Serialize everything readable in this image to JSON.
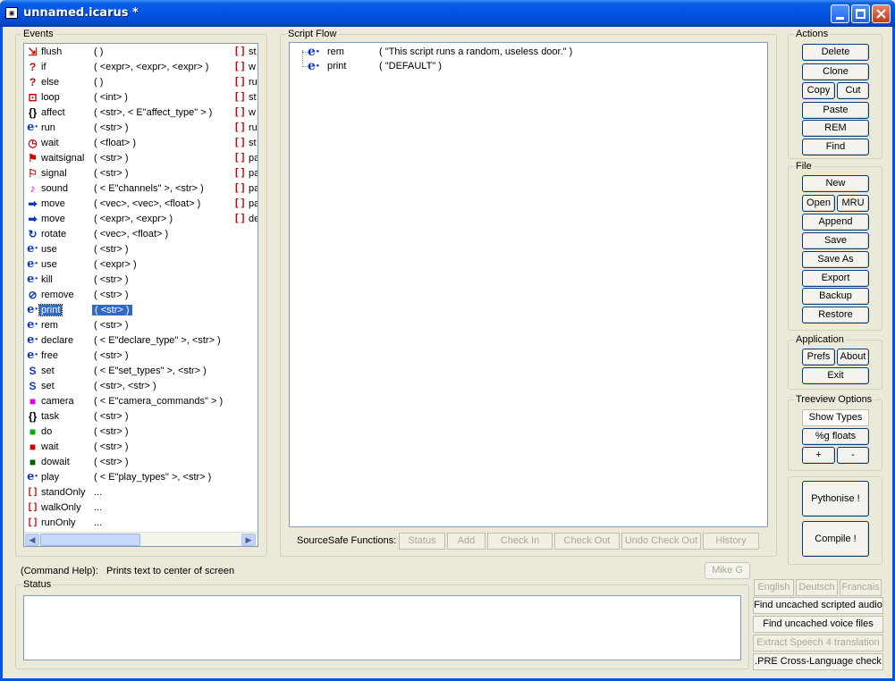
{
  "window": {
    "title": "unnamed.icarus *",
    "icon": "app-icon"
  },
  "events": {
    "legend": "Events",
    "items": [
      {
        "icon": "flush-icon",
        "glyph": "⇲",
        "color": "#d00000",
        "name": "flush",
        "args": "(   )"
      },
      {
        "icon": "if-icon",
        "glyph": "?",
        "color": "#d00000",
        "name": "if",
        "args": "( <expr>, <expr>, <expr> )"
      },
      {
        "icon": "else-icon",
        "glyph": "?",
        "color": "#d00000",
        "name": "else",
        "args": "(   )"
      },
      {
        "icon": "loop-icon",
        "glyph": "⊡",
        "color": "#d00000",
        "name": "loop",
        "args": "( <int> )"
      },
      {
        "icon": "affect-icon",
        "glyph": "{}",
        "color": "#000000",
        "name": "affect",
        "args": "( <str>, < E\"affect_type\" > )"
      },
      {
        "icon": "run-icon",
        "glyph": "e·",
        "color": "#0b36c8",
        "name": "run",
        "args": "( <str> )"
      },
      {
        "icon": "wait-clock-icon",
        "glyph": "◷",
        "color": "#d00000",
        "name": "wait",
        "args": "( <float> )"
      },
      {
        "icon": "waitsignal-icon",
        "glyph": "⚑",
        "color": "#d00000",
        "name": "waitsignal",
        "args": "( <str> )"
      },
      {
        "icon": "signal-icon",
        "glyph": "⚐",
        "color": "#d00000",
        "name": "signal",
        "args": "( <str> )"
      },
      {
        "icon": "sound-icon",
        "glyph": "♪",
        "color": "#e000e0",
        "name": "sound",
        "args": "( < E\"channels\" >, <str> )"
      },
      {
        "icon": "move-arrow-icon",
        "glyph": "➡",
        "color": "#0b36c8",
        "name": "move",
        "args": "( <vec>, <vec>, <float> )"
      },
      {
        "icon": "move-arrow-icon",
        "glyph": "➡",
        "color": "#0b36c8",
        "name": "move",
        "args": "( <expr>, <expr> )"
      },
      {
        "icon": "rotate-icon",
        "glyph": "↻",
        "color": "#0b36c8",
        "name": "rotate",
        "args": "( <vec>, <float> )"
      },
      {
        "icon": "use-icon",
        "glyph": "e·",
        "color": "#0b36c8",
        "name": "use",
        "args": "( <str> )"
      },
      {
        "icon": "use-icon",
        "glyph": "e·",
        "color": "#0b36c8",
        "name": "use",
        "args": "( <expr> )"
      },
      {
        "icon": "kill-icon",
        "glyph": "e·",
        "color": "#0b36c8",
        "name": "kill",
        "args": "( <str> )"
      },
      {
        "icon": "remove-icon",
        "glyph": "⊘",
        "color": "#0b36c8",
        "name": "remove",
        "args": "( <str> )"
      },
      {
        "icon": "print-icon",
        "glyph": "e·",
        "color": "#0b36c8",
        "name": "print",
        "args": "( <str> )"
      },
      {
        "icon": "rem-icon",
        "glyph": "e·",
        "color": "#0b36c8",
        "name": "rem",
        "args": "( <str> )"
      },
      {
        "icon": "declare-icon",
        "glyph": "e·",
        "color": "#0b36c8",
        "name": "declare",
        "args": "( < E\"declare_type\" >, <str> )"
      },
      {
        "icon": "free-icon",
        "glyph": "e·",
        "color": "#0b36c8",
        "name": "free",
        "args": "( <str> )"
      },
      {
        "icon": "set-icon",
        "glyph": "S",
        "color": "#0b36c8",
        "name": "set",
        "args": "( < E\"set_types\" >, <str> )"
      },
      {
        "icon": "set-icon",
        "glyph": "S",
        "color": "#0b36c8",
        "name": "set",
        "args": "( <str>, <str> )"
      },
      {
        "icon": "camera-icon",
        "glyph": "■",
        "color": "#e000e0",
        "name": "camera",
        "args": "( < E\"camera_commands\" > )"
      },
      {
        "icon": "task-icon",
        "glyph": "{}",
        "color": "#000000",
        "name": "task",
        "args": "( <str> )"
      },
      {
        "icon": "do-icon",
        "glyph": "■",
        "color": "#00b000",
        "name": "do",
        "args": "( <str> )"
      },
      {
        "icon": "wait-red-icon",
        "glyph": "■",
        "color": "#d00000",
        "name": "wait",
        "args": "( <str> )"
      },
      {
        "icon": "dowait-icon",
        "glyph": "■",
        "color": "#006000",
        "name": "dowait",
        "args": "( <str> )"
      },
      {
        "icon": "play-icon",
        "glyph": "e·",
        "color": "#0b36c8",
        "name": "play",
        "args": "( < E\"play_types\" >, <str> )"
      },
      {
        "icon": "standonly-icon",
        "glyph": "[ ]",
        "color": "#d00000",
        "name": "standOnly",
        "args": "..."
      },
      {
        "icon": "walkonly-icon",
        "glyph": "[ ]",
        "color": "#d00000",
        "name": "walkOnly",
        "args": "..."
      },
      {
        "icon": "runonly-icon",
        "glyph": "[ ]",
        "color": "#d00000",
        "name": "runOnly",
        "args": "..."
      }
    ],
    "selected_index": 17,
    "second_column": [
      {
        "icon": "bracket-icon",
        "glyph": "[ ]",
        "name": "st"
      },
      {
        "icon": "bracket-icon",
        "glyph": "[ ]",
        "name": "w"
      },
      {
        "icon": "bracket-icon",
        "glyph": "[ ]",
        "name": "ru"
      },
      {
        "icon": "bracket-icon",
        "glyph": "[ ]",
        "name": "st"
      },
      {
        "icon": "bracket-icon",
        "glyph": "[ ]",
        "name": "w"
      },
      {
        "icon": "bracket-icon",
        "glyph": "[ ]",
        "name": "ru"
      },
      {
        "icon": "bracket-icon",
        "glyph": "[ ]",
        "name": "st"
      },
      {
        "icon": "bracket-icon",
        "glyph": "[ ]",
        "name": "pa"
      },
      {
        "icon": "bracket-icon",
        "glyph": "[ ]",
        "name": "pa"
      },
      {
        "icon": "bracket-icon",
        "glyph": "[ ]",
        "name": "pa"
      },
      {
        "icon": "bracket-icon",
        "glyph": "[ ]",
        "name": "pa"
      },
      {
        "icon": "bracket-icon",
        "glyph": "[ ]",
        "name": "de"
      }
    ]
  },
  "script_flow": {
    "legend": "Script Flow",
    "items": [
      {
        "icon": "rem-icon",
        "glyph": "e·",
        "name": "rem",
        "args": "( \"This script runs a random, useless door.\" )"
      },
      {
        "icon": "print-icon",
        "glyph": "e·",
        "name": "print",
        "args": "( \"DEFAULT\" )"
      }
    ]
  },
  "sourcesafe": {
    "label": "SourceSafe Functions:",
    "buttons": [
      "Status",
      "Add",
      "Check In",
      "Check Out",
      "Undo Check Out",
      "History"
    ]
  },
  "actions": {
    "legend": "Actions",
    "delete": "Delete",
    "clone": "Clone",
    "copy": "Copy",
    "cut": "Cut",
    "paste": "Paste",
    "rem": "REM",
    "find": "Find"
  },
  "file": {
    "legend": "File",
    "new": "New",
    "open": "Open",
    "mru": "MRU",
    "append": "Append",
    "save": "Save",
    "save_as": "Save As",
    "export": "Export",
    "backup": "Backup",
    "restore": "Restore"
  },
  "application": {
    "legend": "Application",
    "prefs": "Prefs",
    "about": "About",
    "exit": "Exit"
  },
  "treeview": {
    "legend": "Treeview Options",
    "show_types": "Show Types",
    "g_floats": "%g floats",
    "plus": "+",
    "minus": "-"
  },
  "build": {
    "pythonise": "Pythonise !",
    "compile": "Compile !"
  },
  "command_help": {
    "label": "(Command Help):",
    "text": "Prints text to center of screen"
  },
  "user_button": "Mike G",
  "status": {
    "legend": "Status",
    "text": ""
  },
  "language": {
    "english": "English",
    "deutsch": "Deutsch",
    "francais": "Francais"
  },
  "tools": {
    "find_audio": "Find uncached scripted audio",
    "find_voice": "Find uncached voice files",
    "extract_speech": "Extract Speech 4 translation",
    "pre_check": ".PRE Cross-Language check"
  }
}
